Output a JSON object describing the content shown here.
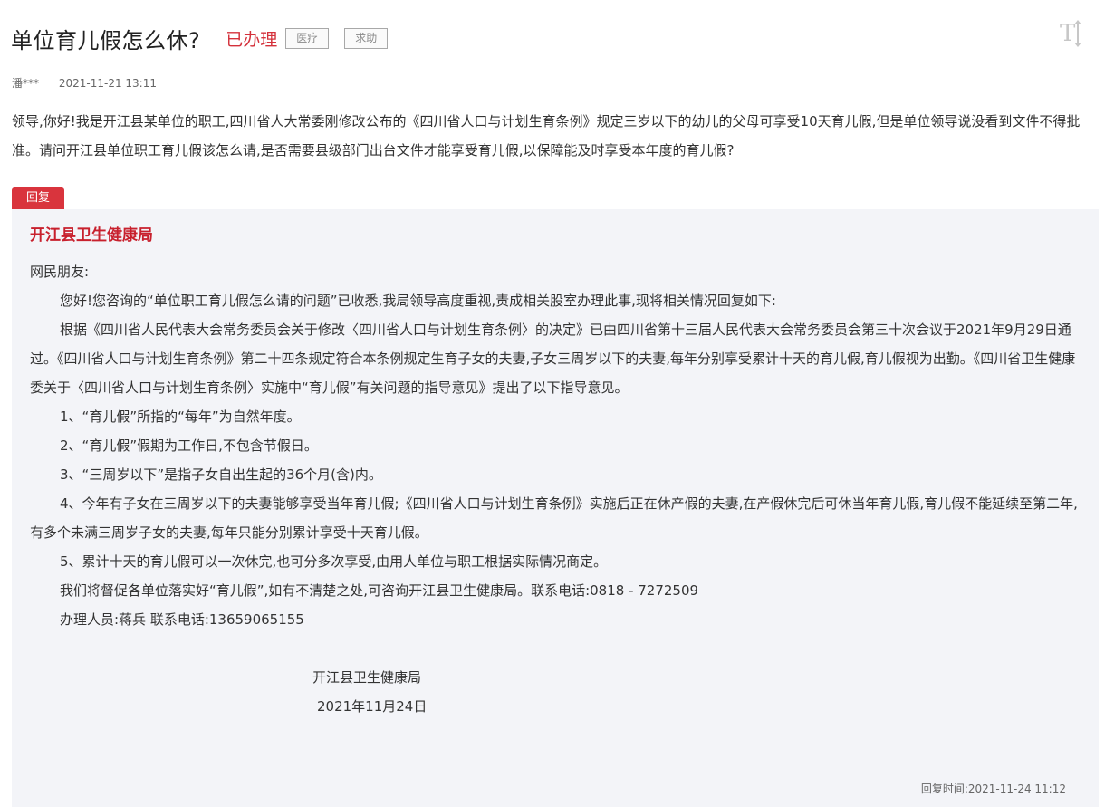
{
  "header": {
    "title": "单位育儿假怎么休?",
    "status": "已办理",
    "tags": [
      "医疗",
      "求助"
    ],
    "font_toggle_icon": "font-size-toggle-icon"
  },
  "meta": {
    "author": "潘***",
    "date": "2021-11-21 13:11"
  },
  "question": "领导,你好!我是开江县某单位的职工,四川省人大常委刚修改公布的《四川省人口与计划生育条例》规定三岁以下的幼儿的父母可享受10天育儿假,但是单位领导说没看到文件不得批准。请问开江县单位职工育儿假该怎么请,是否需要县级部门出台文件才能享受育儿假,以保障能及时享受本年度的育儿假?",
  "reply": {
    "tab_label": "回复",
    "department": "开江县卫生健康局",
    "greeting": "网民朋友:",
    "paragraphs": [
      "您好!您咨询的“单位职工育儿假怎么请的问题”已收悉,我局领导高度重视,责成相关股室办理此事,现将相关情况回复如下:",
      "根据《四川省人民代表大会常务委员会关于修改〈四川省人口与计划生育条例〉的决定》已由四川省第十三届人民代表大会常务委员会第三十次会议于2021年9月29日通过。《四川省人口与计划生育条例》第二十四条规定符合本条例规定生育子女的夫妻,子女三周岁以下的夫妻,每年分别享受累计十天的育儿假,育儿假视为出勤。《四川省卫生健康委关于〈四川省人口与计划生育条例〉实施中“育儿假”有关问题的指导意见》提出了以下指导意见。",
      "1、“育儿假”所指的“每年”为自然年度。",
      "2、“育儿假”假期为工作日,不包含节假日。",
      "3、“三周岁以下”是指子女自出生起的36个月(含)内。",
      "4、今年有子女在三周岁以下的夫妻能够享受当年育儿假;《四川省人口与计划生育条例》实施后正在休产假的夫妻,在产假休完后可休当年育儿假,育儿假不能延续至第二年,有多个未满三周岁子女的夫妻,每年只能分别累计享受十天育儿假。",
      "5、累计十天的育儿假可以一次休完,也可分多次享受,由用人单位与职工根据实际情况商定。",
      "我们将督促各单位落实好“育儿假”,如有不清楚之处,可咨询开江县卫生健康局。联系电话:0818 - 7272509",
      "办理人员:蒋兵 联系电话:13659065155"
    ],
    "signature": "开江县卫生健康局",
    "signature_date": "2021年11月24日",
    "reply_time": "回复时间:2021-11-24 11:12"
  }
}
